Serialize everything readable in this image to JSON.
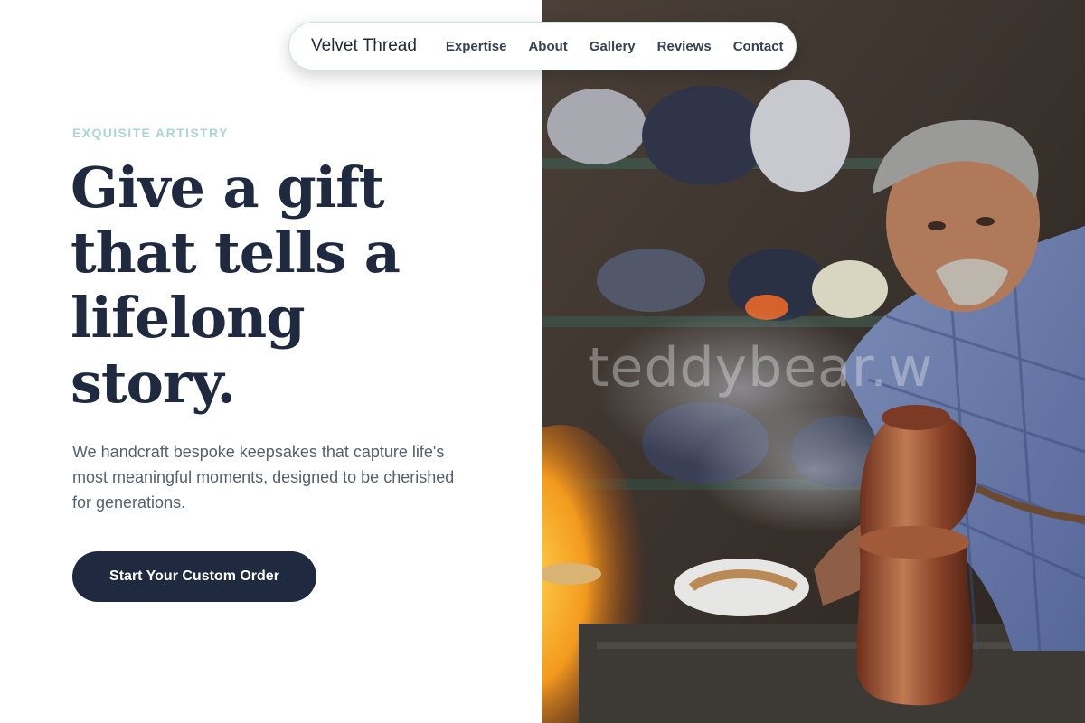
{
  "nav": {
    "brand": "Velvet Thread",
    "links": [
      "Expertise",
      "About",
      "Gallery",
      "Reviews",
      "Contact"
    ]
  },
  "hero": {
    "eyebrow": "EXQUISITE ARTISTRY",
    "headline_lines": [
      "Give a gift",
      "that tells a",
      "lifelong",
      "story."
    ],
    "subtext": "We handcraft bespoke keepsakes that capture life's most meaningful moments, designed to be cherished for generations.",
    "cta_label": "Start Your Custom Order"
  },
  "photo": {
    "watermark": "teddybear.w"
  },
  "colors": {
    "navy": "#1f2a40",
    "teal_accent": "#a9d6d1",
    "body_text": "#555f6d"
  }
}
